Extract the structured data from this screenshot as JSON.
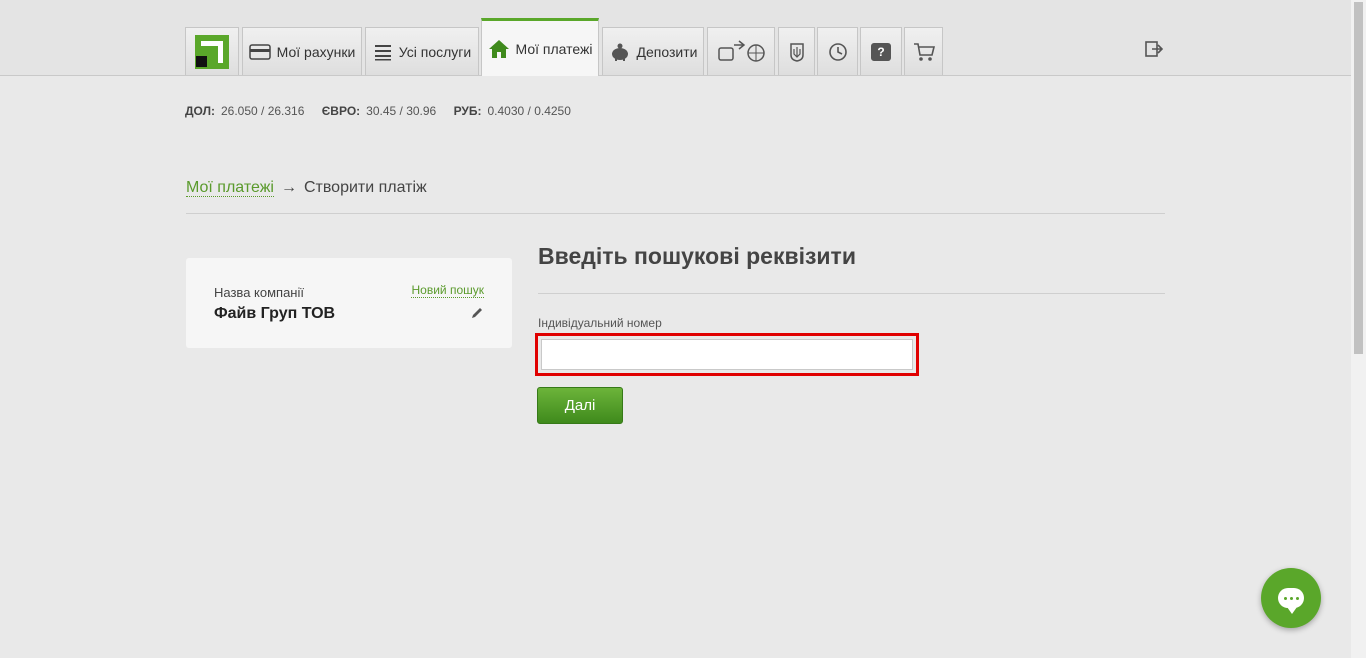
{
  "nav": {
    "tabs": [
      {
        "label": "Мої рахунки",
        "icon": "card-icon"
      },
      {
        "label": "Усі послуги",
        "icon": "list-icon"
      },
      {
        "label": "Мої платежі",
        "icon": "home-icon"
      },
      {
        "label": "Депозити",
        "icon": "piggy-bank-icon"
      }
    ],
    "icon_tabs": [
      "transport-icon",
      "ukraine-emblem-icon",
      "history-icon",
      "help-icon",
      "cart-icon"
    ],
    "help_glyph": "?"
  },
  "rates": {
    "usd_label": "ДОЛ:",
    "usd_value": "26.050 / 26.316",
    "eur_label": "ЄВРО:",
    "eur_value": "30.45 / 30.96",
    "rub_label": "РУБ:",
    "rub_value": "0.4030 / 0.4250"
  },
  "breadcrumb": {
    "link": "Мої платежі",
    "arrow": "→",
    "current": "Створити платіж"
  },
  "company": {
    "label": "Назва компанії",
    "name": "Файв Груп ТОВ",
    "new_search": "Новий пошук"
  },
  "form": {
    "title": "Введіть пошукові реквізити",
    "field_label": "Індивідуальний номер",
    "field_value": "",
    "submit": "Далі"
  },
  "colors": {
    "accent": "#5aa72a",
    "highlight": "#e00000"
  }
}
